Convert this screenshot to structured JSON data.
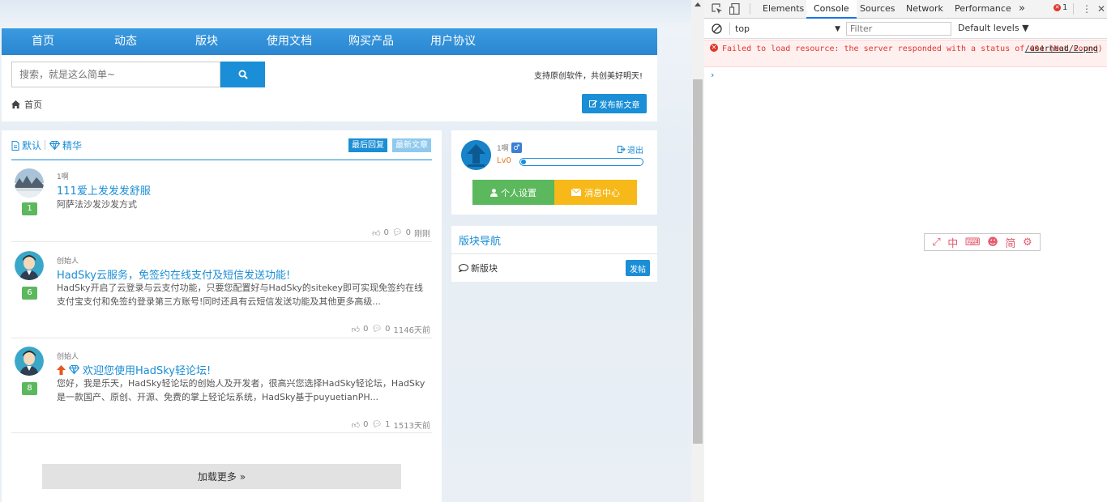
{
  "nav": {
    "items": [
      "首页",
      "动态",
      "版块",
      "使用文档",
      "购买产品",
      "用户协议"
    ]
  },
  "search": {
    "placeholder": "搜索，就是这么简单~"
  },
  "slogan": "支持原创软件，共创美好明天!",
  "breadcrumb": {
    "home": "首页"
  },
  "publish_button": "发布新文章",
  "tabs": {
    "default": "默认",
    "featured": "精华",
    "sort_reply": "最后回复",
    "sort_new": "最新文章"
  },
  "posts": [
    {
      "author": "1啊",
      "level": "1",
      "title": "111爱上发发发舒服",
      "excerpt": "阿萨法沙发沙发方式",
      "likes": "0",
      "comments": "0",
      "time": "刚刚"
    },
    {
      "author": "创始人",
      "level": "6",
      "title": "HadSky云服务，免签约在线支付及短信发送功能!",
      "excerpt": "HadSky开启了云登录与云支付功能，只要您配置好与HadSky的sitekey即可实现免签约在线支付宝支付和免签约登录第三方账号!同时还具有云短信发送功能及其他更多高级...",
      "likes": "0",
      "comments": "0",
      "time": "1146天前"
    },
    {
      "author": "创始人",
      "level": "8",
      "title": "欢迎您使用HadSky轻论坛!",
      "excerpt": "您好，我是乐天，HadSky轻论坛的创始人及开发者，很高兴您选择HadSky轻论坛，HadSky是一款国产、原创、开源、免费的掌上轻论坛系统，HadSky基于puyuetianPH...",
      "likes": "0",
      "comments": "1",
      "time": "1513天前"
    }
  ],
  "load_more": "加载更多 »",
  "user": {
    "name": "1啊",
    "gender": "♂",
    "level": "Lv0",
    "progress": 0.03,
    "logout": "退出",
    "settings": "个人设置",
    "messages": "消息中心"
  },
  "forum_nav": {
    "title": "版块导航",
    "board": "新版块",
    "post_button": "发帖"
  },
  "devtools": {
    "tabs": [
      "Elements",
      "Console",
      "Sources",
      "Network",
      "Performance"
    ],
    "active_tab": "Console",
    "more": "»",
    "error_count": "1",
    "context": "top",
    "filter_placeholder": "Filter",
    "levels": "Default levels ▼",
    "error_message": "Failed to load resource: the server responded with a status of 404 (Not Found)",
    "error_link": "/userhead/2.png",
    "prompt": "›"
  },
  "ime": {
    "icons": [
      "⤢",
      "中",
      "⌨",
      "☻",
      "简",
      "⚙"
    ]
  },
  "colors": {
    "brand": "#1a8ed6",
    "green": "#5cb85c",
    "orange": "#f7b81a",
    "error": "#e0352b"
  }
}
